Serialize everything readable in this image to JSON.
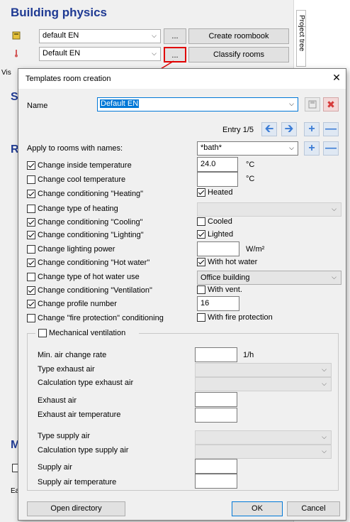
{
  "background": {
    "title": "Building physics",
    "row1_select": "default EN",
    "row1_dots": "...",
    "row1_button": "Create roombook",
    "row2_select": "Default EN",
    "row2_dots": "...",
    "row2_button": "Classify rooms",
    "side_tab": "Project tree",
    "partial_labels": {
      "vis": "Vis",
      "s": "S",
      "r": "R",
      "m": "M",
      "ea": "Ea"
    }
  },
  "dialog": {
    "title": "Templates room creation",
    "close": "✕",
    "name_label": "Name",
    "name_value": "Default EN",
    "entry_label": "Entry 1/5",
    "apply_label": "Apply to rooms with names:",
    "apply_value": "*bath*",
    "rows": {
      "inside_temp": {
        "label": "Change inside temperature",
        "value": "24.0",
        "unit": "°C"
      },
      "cool_temp": {
        "label": "Change cool temperature",
        "value": "",
        "unit": "°C"
      },
      "heating": {
        "label": "Change conditioning \"Heating\"",
        "opt": "Heated"
      },
      "heating_type": {
        "label": "Change type of heating",
        "value": ""
      },
      "cooling": {
        "label": "Change conditioning \"Cooling\"",
        "opt": "Cooled"
      },
      "lighting": {
        "label": "Change conditioning \"Lighting\"",
        "opt": "Lighted"
      },
      "lighting_power": {
        "label": "Change lighting power",
        "value": "",
        "unit": "W/m²"
      },
      "hot_water": {
        "label": "Change conditioning \"Hot water\"",
        "opt": "With hot water"
      },
      "hot_water_use": {
        "label": "Change type of hot water use",
        "value": "Office building"
      },
      "ventilation": {
        "label": "Change conditioning \"Ventilation\"",
        "opt": "With vent."
      },
      "profile": {
        "label": "Change profile number",
        "value": "16"
      },
      "fire": {
        "label": "Change \"fire protection\" conditioning",
        "opt": "With fire protection"
      }
    },
    "mech_vent": "Mechanical ventilation",
    "vent": {
      "min_air": "Min. air change rate",
      "min_air_unit": "1/h",
      "type_exhaust": "Type exhaust air",
      "calc_exhaust": "Calculation type exhaust air",
      "exhaust_air": "Exhaust air",
      "exhaust_temp": "Exhaust air temperature",
      "type_supply": "Type supply air",
      "calc_supply": "Calculation type supply air",
      "supply_air": "Supply air",
      "supply_temp": "Supply air temperature"
    },
    "buttons": {
      "open_dir": "Open directory",
      "ok": "OK",
      "cancel": "Cancel"
    }
  }
}
